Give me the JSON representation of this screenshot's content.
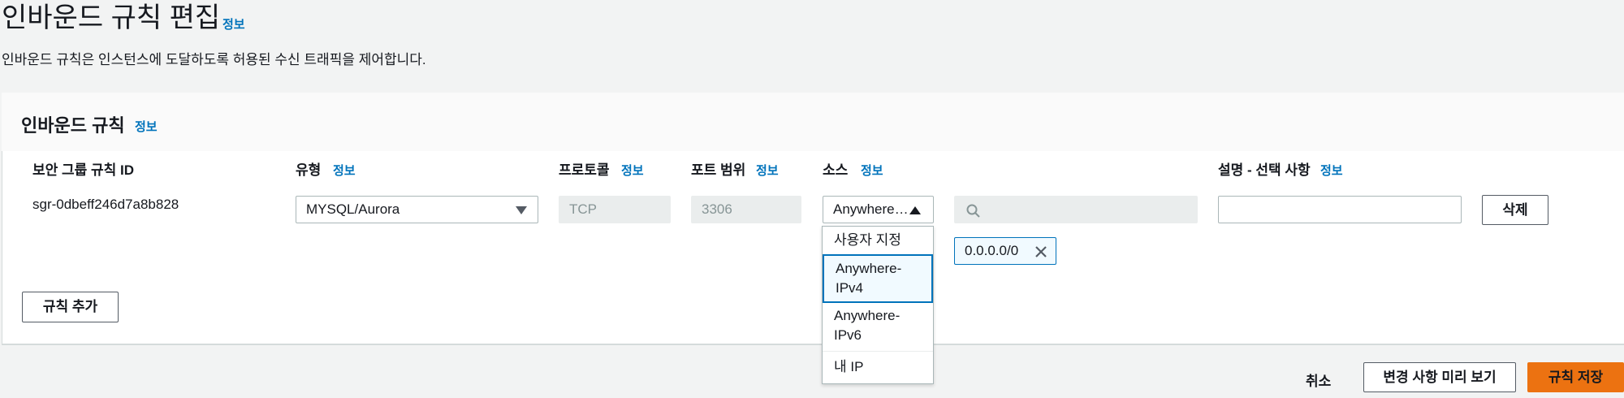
{
  "page": {
    "title": "인바운드 규칙 편집",
    "info": "정보",
    "description": "인바운드 규칙은 인스턴스에 도달하도록 허용된 수신 트래픽을 제어합니다."
  },
  "panel": {
    "title": "인바운드 규칙",
    "info": "정보",
    "columns": {
      "rule_id": "보안 그룹 규칙 ID",
      "type": "유형",
      "protocol": "프로토콜",
      "port_range": "포트 범위",
      "source": "소스",
      "description": "설명 - 선택 사항"
    },
    "rule": {
      "id": "sgr-0dbeff246d7a8b828",
      "type": "MYSQL/Aurora",
      "protocol": "TCP",
      "port": "3306",
      "source_selected": "Anywhere…",
      "cidr": "0.0.0.0/0",
      "description_value": "",
      "delete_label": "삭제"
    },
    "source_options": [
      "사용자 지정",
      "Anywhere-IPv4",
      "Anywhere-IPv6",
      "내 IP"
    ],
    "add_rule_label": "규칙 추가"
  },
  "footer": {
    "cancel_label": "취소",
    "preview_label": "변경 사항 미리 보기",
    "save_label": "규칙 저장"
  },
  "colors": {
    "link": "#0073bb",
    "primary": "#ec7211",
    "selected_bg": "#f1faff"
  }
}
